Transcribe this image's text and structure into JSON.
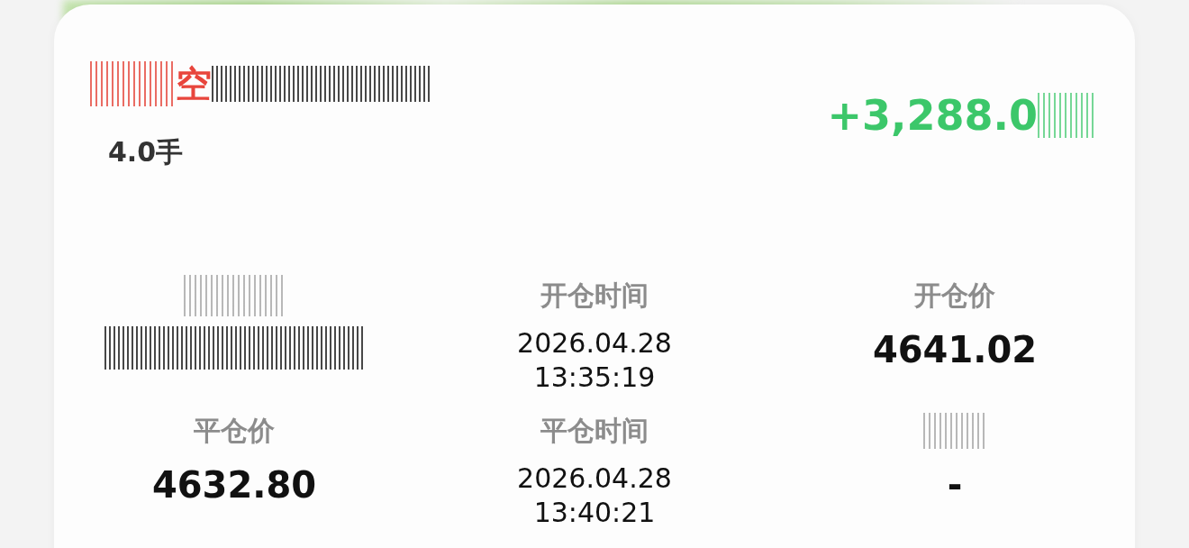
{
  "trade": {
    "direction": "空",
    "lots": "4.0手",
    "pnl": "+3,288.0"
  },
  "fields": [
    {
      "kind": "obscured"
    },
    {
      "kind": "time",
      "label": "开仓时间",
      "date": "2026.04.28",
      "time": "13:35:19"
    },
    {
      "kind": "price",
      "label": "开仓价",
      "value": "4641.02"
    },
    {
      "kind": "price",
      "label": "平仓价",
      "value": "4632.80"
    },
    {
      "kind": "time",
      "label": "平仓时间",
      "date": "2026.04.28",
      "time": "13:40:21"
    },
    {
      "kind": "price",
      "value": "-"
    }
  ]
}
